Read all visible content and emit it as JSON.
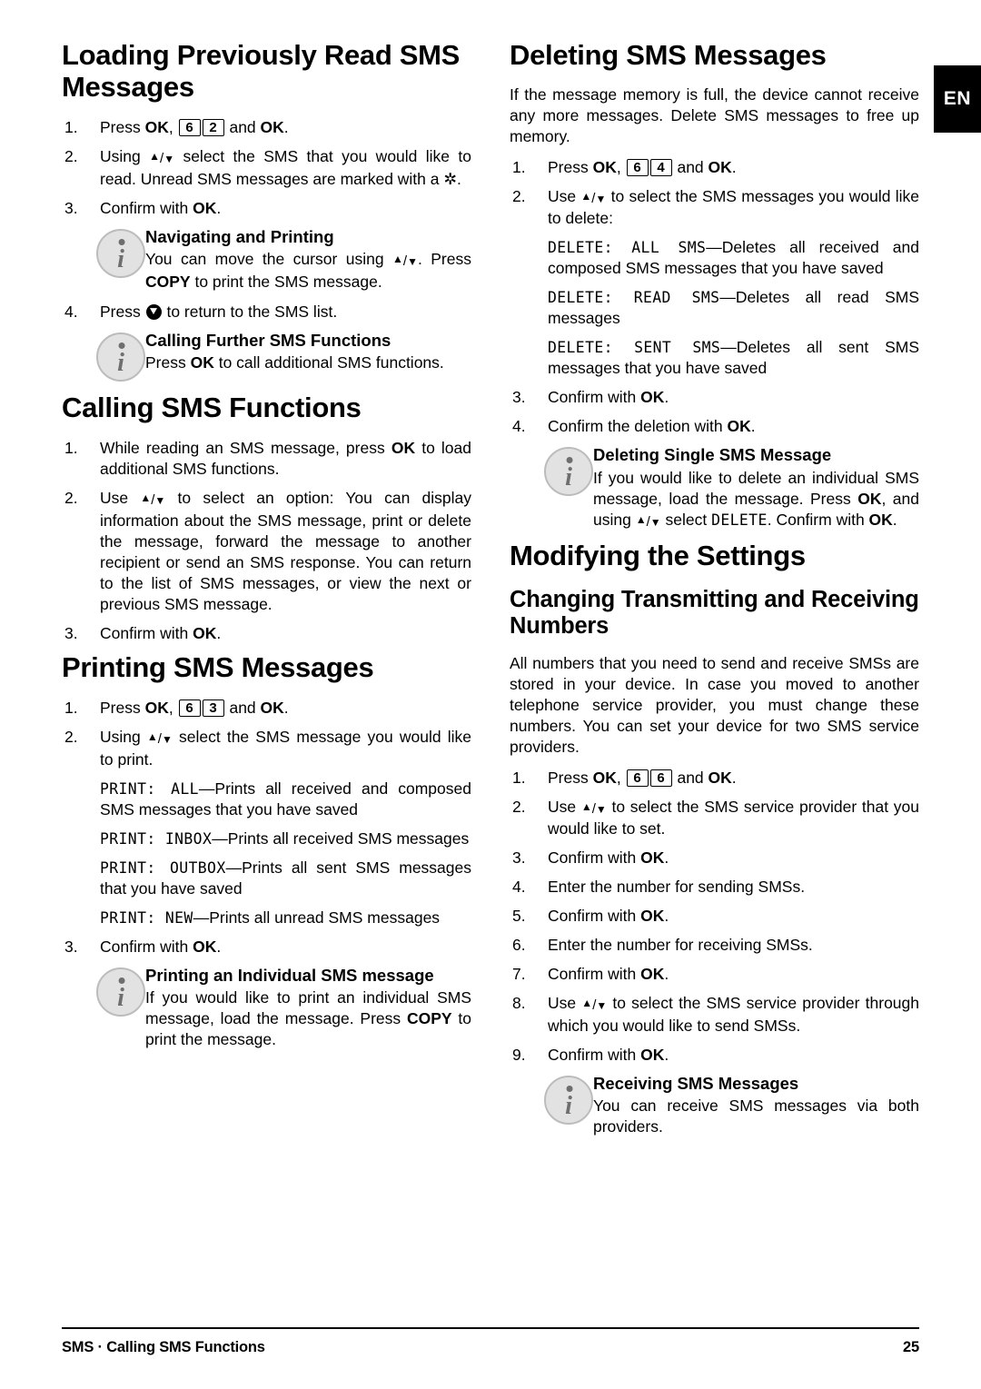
{
  "lang_tab": "EN",
  "footer": {
    "left": "SMS · Calling SMS Functions",
    "page": "25"
  },
  "left_column": {
    "section1": {
      "heading": "Loading Previously Read SMS Messages",
      "step1_pre": "Press ",
      "step1_ok1": "OK",
      "step1_comma": ", ",
      "step1_key1": "6",
      "step1_key2": "2",
      "step1_and": " and ",
      "step1_ok2": "OK",
      "step1_end": ".",
      "step2_a": "Using ",
      "step2_b": " select the SMS that you would like to read. Unread SMS messages are marked with a ",
      "step2_star": "✲",
      "step2_c": ".",
      "step3": "Confirm with ",
      "step3_ok": "OK",
      "step3_end": ".",
      "note1_title": "Navigating and Printing",
      "note1_a": "You can move the cursor using ",
      "note1_b": ". Press ",
      "note1_copy": "COPY",
      "note1_c": " to print the SMS message.",
      "step4_a": "Press ",
      "step4_b": " to return to the SMS list.",
      "note2_title": "Calling Further SMS Functions",
      "note2_a": "Press ",
      "note2_ok": "OK",
      "note2_b": " to call additional SMS functions."
    },
    "section2": {
      "heading": "Calling SMS Functions",
      "step1_a": "While reading an SMS message, press ",
      "step1_ok": "OK",
      "step1_b": " to load additional SMS functions.",
      "step2_a": "Use ",
      "step2_b": " to select an option: You can display information about the SMS message, print or delete the message, forward the message to another recipient or send an SMS response. You can return to the list of SMS messages, or view the next or previous SMS message.",
      "step3": "Confirm with ",
      "step3_ok": "OK",
      "step3_end": "."
    },
    "section3": {
      "heading": "Printing SMS Messages",
      "step1_pre": "Press ",
      "step1_ok1": "OK",
      "step1_comma": ", ",
      "step1_key1": "6",
      "step1_key2": "3",
      "step1_and": " and ",
      "step1_ok2": "OK",
      "step1_end": ".",
      "step2_a": "Using ",
      "step2_b": " select the SMS message you would like to print.",
      "options": [
        {
          "lcd": "PRINT: ALL",
          "dash": "—",
          "text": "Prints all received and composed SMS messages that you have saved"
        },
        {
          "lcd": "PRINT: INBOX",
          "dash": "—",
          "text": "Prints all received SMS messages"
        },
        {
          "lcd": "PRINT: OUTBOX",
          "dash": "—",
          "text": "Prints all sent SMS messages that you have saved"
        },
        {
          "lcd": "PRINT: NEW",
          "dash": "—",
          "text": "Prints all unread SMS messages"
        }
      ],
      "step3": "Confirm with ",
      "step3_ok": "OK",
      "step3_end": ".",
      "note_title": "Printing an Individual SMS message",
      "note_a": "If you would like to print an individual SMS message, load the message. Press ",
      "note_copy": "COPY",
      "note_b": " to print the message."
    }
  },
  "right_column": {
    "section1": {
      "heading": "Deleting SMS Messages",
      "intro": "If the message memory is full, the device cannot receive any more messages. Delete SMS messages to free up memory.",
      "step1_pre": "Press ",
      "step1_ok1": "OK",
      "step1_comma": ", ",
      "step1_key1": "6",
      "step1_key2": "4",
      "step1_and": " and ",
      "step1_ok2": "OK",
      "step1_end": ".",
      "step2_a": "Use ",
      "step2_b": " to select the SMS messages you would like to delete:",
      "options": [
        {
          "lcd": "DELETE: ALL SMS",
          "dash": "—",
          "text": "Deletes all received and composed SMS messages that you have saved"
        },
        {
          "lcd": "DELETE: READ SMS",
          "dash": "—",
          "text": "Deletes all read SMS messages"
        },
        {
          "lcd": "DELETE: SENT SMS",
          "dash": "—",
          "text": "Deletes all sent SMS messages that you have saved"
        }
      ],
      "step3": "Confirm with ",
      "step3_ok": "OK",
      "step3_end": ".",
      "step4": "Confirm the deletion with ",
      "step4_ok": "OK",
      "step4_end": ".",
      "note_title": "Deleting Single SMS Message",
      "note_a": "If you would like to delete an individual SMS message, load the message. Press ",
      "note_ok1": "OK",
      "note_b": ", and using ",
      "note_c": " select ",
      "note_lcd": "DELETE",
      "note_d": ". Confirm with ",
      "note_ok2": "OK",
      "note_e": "."
    },
    "section2": {
      "heading": "Modifying the Settings",
      "subheading": "Changing Transmitting and Receiving Numbers",
      "intro": "All numbers that you need to send and receive SMSs are stored in your device. In case you moved to another telephone service provider, you must change these numbers. You can set your device for two SMS service providers.",
      "step1_pre": "Press ",
      "step1_ok1": "OK",
      "step1_comma": ", ",
      "step1_key1": "6",
      "step1_key2": "6",
      "step1_and": " and ",
      "step1_ok2": "OK",
      "step1_end": ".",
      "step2_a": "Use ",
      "step2_b": " to select the SMS service provider that you would like to set.",
      "step3": "Confirm with ",
      "step3_ok": "OK",
      "step3_end": ".",
      "step4": "Enter the number for sending SMSs.",
      "step5": "Confirm with ",
      "step5_ok": "OK",
      "step5_end": ".",
      "step6": "Enter the number for receiving SMSs.",
      "step7": "Confirm with ",
      "step7_ok": "OK",
      "step7_end": ".",
      "step8_a": "Use ",
      "step8_b": " to select the SMS service provider through which you would like to send SMSs.",
      "step9": "Confirm with ",
      "step9_ok": "OK",
      "step9_end": ".",
      "note_title": "Receiving SMS Messages",
      "note_text": "You can receive SMS messages via both providers."
    }
  },
  "numbers": {
    "n1": "1.",
    "n2": "2.",
    "n3": "3.",
    "n4": "4.",
    "n5": "5.",
    "n6": "6.",
    "n7": "7.",
    "n8": "8.",
    "n9": "9."
  }
}
